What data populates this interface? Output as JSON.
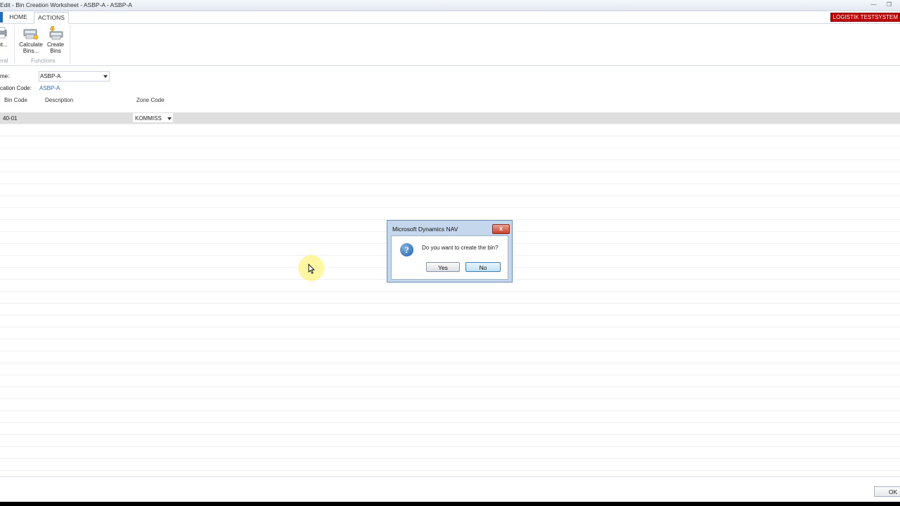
{
  "window": {
    "title": "Edit - Bin Creation Worksheet - ASBP-A - ASBP-A"
  },
  "ribbon": {
    "tabs": [
      {
        "label": "HOME"
      },
      {
        "label": "ACTIONS"
      }
    ],
    "brand_badge": "LOGISTIK TESTSYSTEM",
    "partial_button_label": "nt...",
    "partial_group_label": "eral",
    "buttons": [
      {
        "label_line1": "Calculate",
        "label_line2": "Bins...",
        "icon": "calculate-bins-icon"
      },
      {
        "label_line1": "Create",
        "label_line2": "Bins",
        "icon": "create-bins-icon"
      }
    ],
    "functions_group_label": "Functions"
  },
  "header": {
    "name_label": "me:",
    "name_value": "ASBP-A",
    "location_label": "cation Code:",
    "location_value": "ASBP-A"
  },
  "grid": {
    "columns": [
      "Bin Code",
      "Description",
      "Zone Code"
    ],
    "rows": [
      {
        "bin_code": "40-01",
        "description": "",
        "zone_code": "KOMMISS"
      }
    ]
  },
  "dialog": {
    "title": "Microsoft Dynamics NAV",
    "close_label": "x",
    "icon": "question-icon",
    "message": "Do you want to create the bin?",
    "yes_label": "Yes",
    "no_label": "No"
  },
  "footer": {
    "ok_label": "OK"
  }
}
